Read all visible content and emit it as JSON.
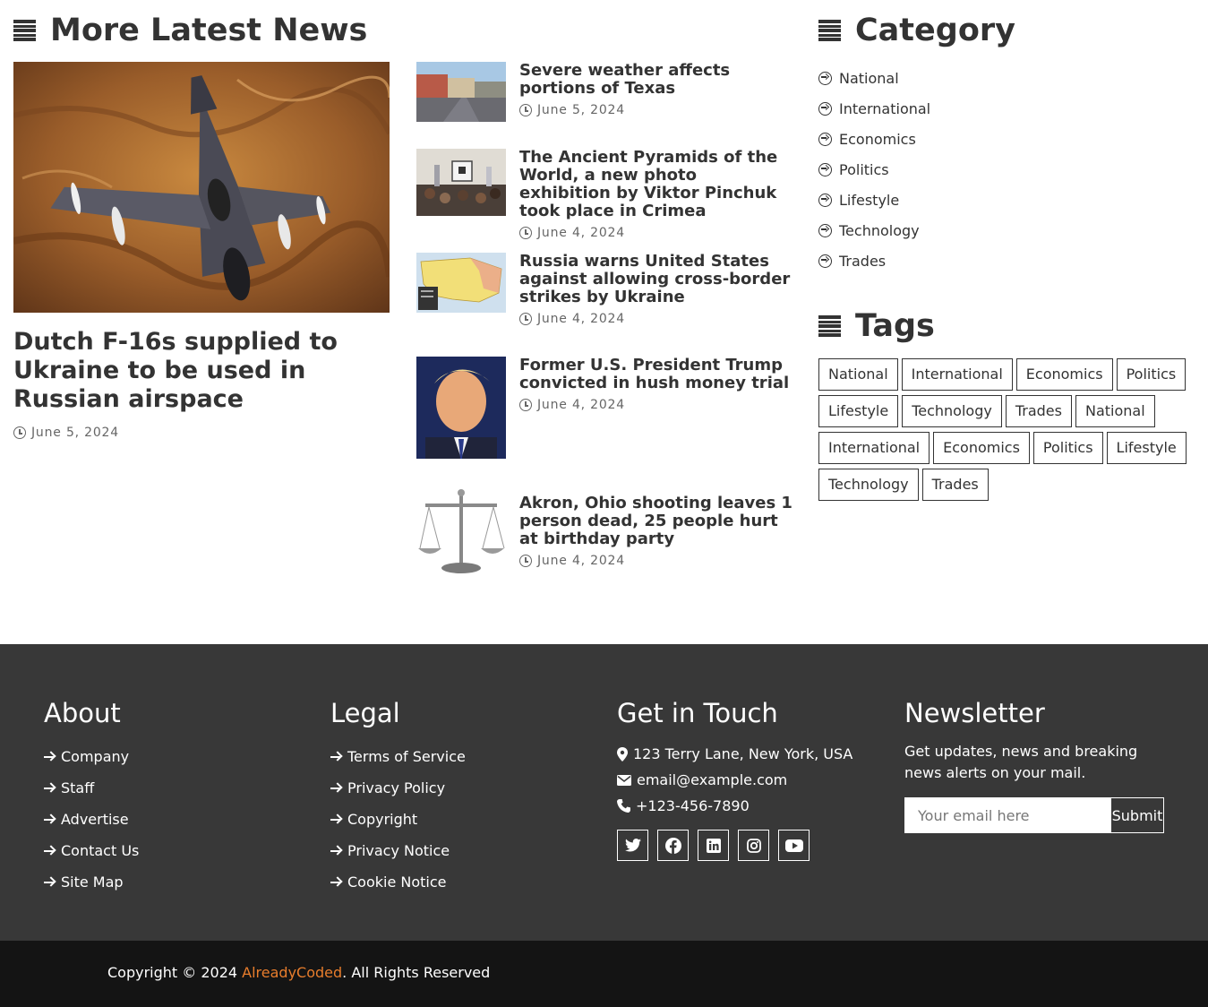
{
  "latest": {
    "heading": "More Latest News",
    "featured": {
      "title": "Dutch F-16s supplied to Ukraine to be used in Russian airspace",
      "date": "June 5, 2024"
    },
    "items": [
      {
        "title": "Severe weather affects portions of Texas",
        "date": "June 5, 2024"
      },
      {
        "title": "The Ancient Pyramids of the World, a new photo exhibition by Viktor Pinchuk took place in Crimea",
        "date": "June 4, 2024"
      },
      {
        "title": "Russia warns United States against allowing cross-border strikes by Ukraine",
        "date": "June 4, 2024"
      },
      {
        "title": "Former U.S. President Trump convicted in hush money trial",
        "date": "June 4, 2024"
      },
      {
        "title": "Akron, Ohio shooting leaves 1 person dead, 25 people hurt at birthday party",
        "date": "June 4, 2024"
      }
    ]
  },
  "category": {
    "heading": "Category",
    "items": [
      "National",
      "International",
      "Economics",
      "Politics",
      "Lifestyle",
      "Technology",
      "Trades"
    ]
  },
  "tags": {
    "heading": "Tags",
    "items": [
      "National",
      "International",
      "Economics",
      "Politics",
      "Lifestyle",
      "Technology",
      "Trades",
      "National",
      "International",
      "Economics",
      "Politics",
      "Lifestyle",
      "Technology",
      "Trades"
    ]
  },
  "footer": {
    "about": {
      "heading": "About",
      "links": [
        "Company",
        "Staff",
        "Advertise",
        "Contact Us",
        "Site Map"
      ]
    },
    "legal": {
      "heading": "Legal",
      "links": [
        "Terms of Service",
        "Privacy Policy",
        "Copyright",
        "Privacy Notice",
        "Cookie Notice"
      ]
    },
    "contact": {
      "heading": "Get in Touch",
      "address": "123 Terry Lane, New York, USA",
      "email": "email@example.com",
      "phone": "+123-456-7890",
      "socials": [
        "twitter-icon",
        "facebook-icon",
        "linkedin-icon",
        "instagram-icon",
        "youtube-icon"
      ]
    },
    "newsletter": {
      "heading": "Newsletter",
      "text": "Get updates, news and breaking news alerts on your mail.",
      "placeholder": "Your email here",
      "submit": "Submit"
    }
  },
  "copyright": {
    "prefix": "Copyright © 2024 ",
    "brand": "AlreadyCoded",
    "suffix": ". All Rights Reserved"
  },
  "colors": {
    "footer_bg": "#383838",
    "bottom_bg": "#141414",
    "brand": "#e87d2c",
    "text": "#333333"
  }
}
